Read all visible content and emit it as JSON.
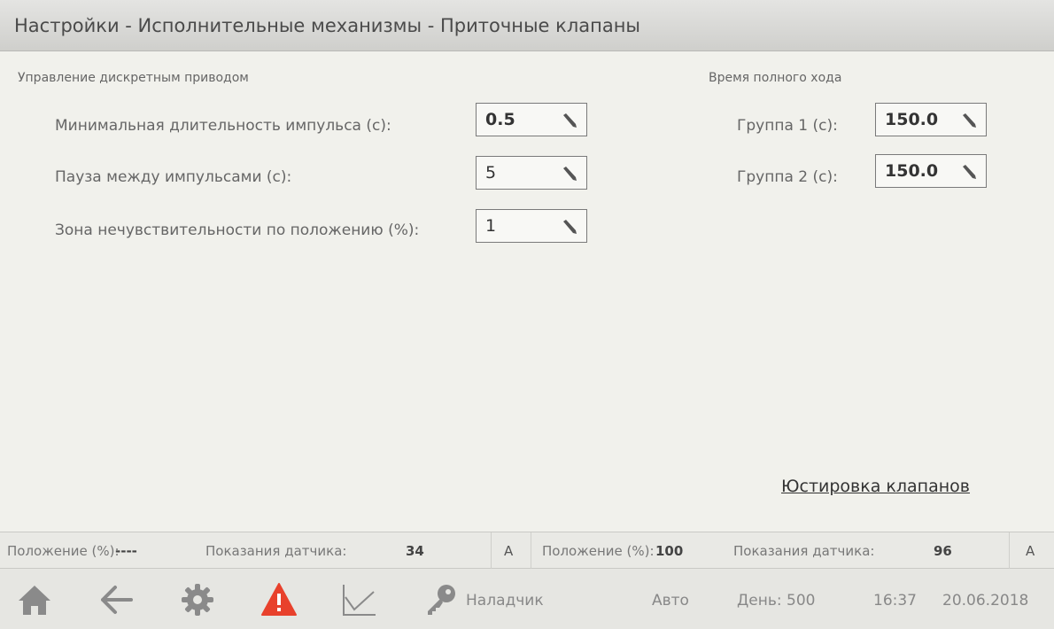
{
  "window": {
    "title": "Настройки - Исполнительные механизмы - Приточные клапаны"
  },
  "discrete": {
    "section_label": "Управление дискретным приводом",
    "min_pulse": {
      "label": "Минимальная длительность импульса (с):",
      "value": "0.5"
    },
    "pause": {
      "label": "Пауза между импульсами (с):",
      "value": "5"
    },
    "deadband": {
      "label": "Зона нечувствительности по положению (%):",
      "value": "1"
    }
  },
  "stroke_time": {
    "section_label": "Время полного хода",
    "group1": {
      "label": "Группа 1 (с):",
      "value": "150.0"
    },
    "group2": {
      "label": "Группа 2 (с):",
      "value": "150.0"
    }
  },
  "calibration_link": "Юстировка клапанов",
  "status": {
    "left": {
      "position_label": "Положение (%):",
      "position_value": "----",
      "sensor_label": "Показания датчика:",
      "sensor_value": "34",
      "mode": "A"
    },
    "right": {
      "position_label": "Положение (%):",
      "position_value": "100",
      "sensor_label": "Показания датчика:",
      "sensor_value": "96",
      "mode": "A"
    }
  },
  "bottom": {
    "user": "Наладчик",
    "mode": "Авто",
    "day": "День: 500",
    "time": "16:37",
    "date": "20.06.2018",
    "icons": [
      "home-icon",
      "back-arrow-icon",
      "gear-icon",
      "alarm-warning-icon",
      "chart-icon",
      "key-icon"
    ],
    "colors": {
      "alarm": "#e8412c",
      "icons": "#888888"
    }
  }
}
